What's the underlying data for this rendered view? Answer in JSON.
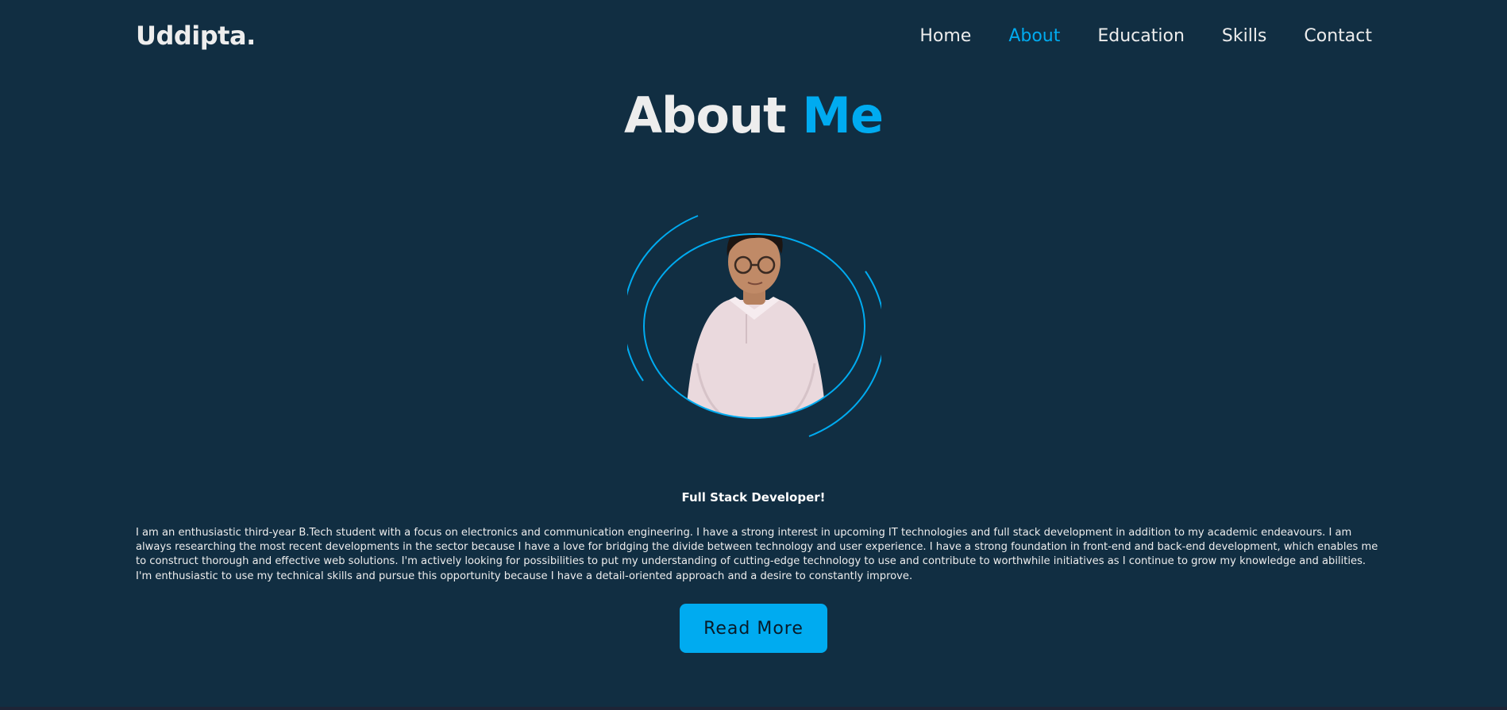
{
  "header": {
    "logo": "Uddipta.",
    "nav": [
      "Home",
      "About",
      "Education",
      "Skills",
      "Contact"
    ],
    "active_nav": "About"
  },
  "about": {
    "heading_main": "About",
    "heading_accent": "Me",
    "photo_alt": "Profile photo",
    "subtitle": "Full Stack Developer!",
    "bio": "I am an enthusiastic third-year B.Tech student with a focus on electronics and communication engineering. I have a strong interest in upcoming IT technologies and full stack development in addition to my academic endeavours. I am always researching the most recent developments in the sector because I have a love for bridging the divide between technology and user experience. I have a strong foundation in front-end and back-end development, which enables me to construct thorough and effective web solutions. I'm actively looking for possibilities to put my understanding of cutting-edge technology to use and contribute to worthwhile initiatives as I continue to grow my knowledge and abilities. I'm enthusiastic to use my technical skills and pursue this opportunity because I have a detail-oriented approach and a desire to constantly improve.",
    "button": "Read More"
  },
  "colors": {
    "background": "#112e42",
    "accent": "#00abf0",
    "text": "#ededed",
    "button_text": "#081b29"
  }
}
